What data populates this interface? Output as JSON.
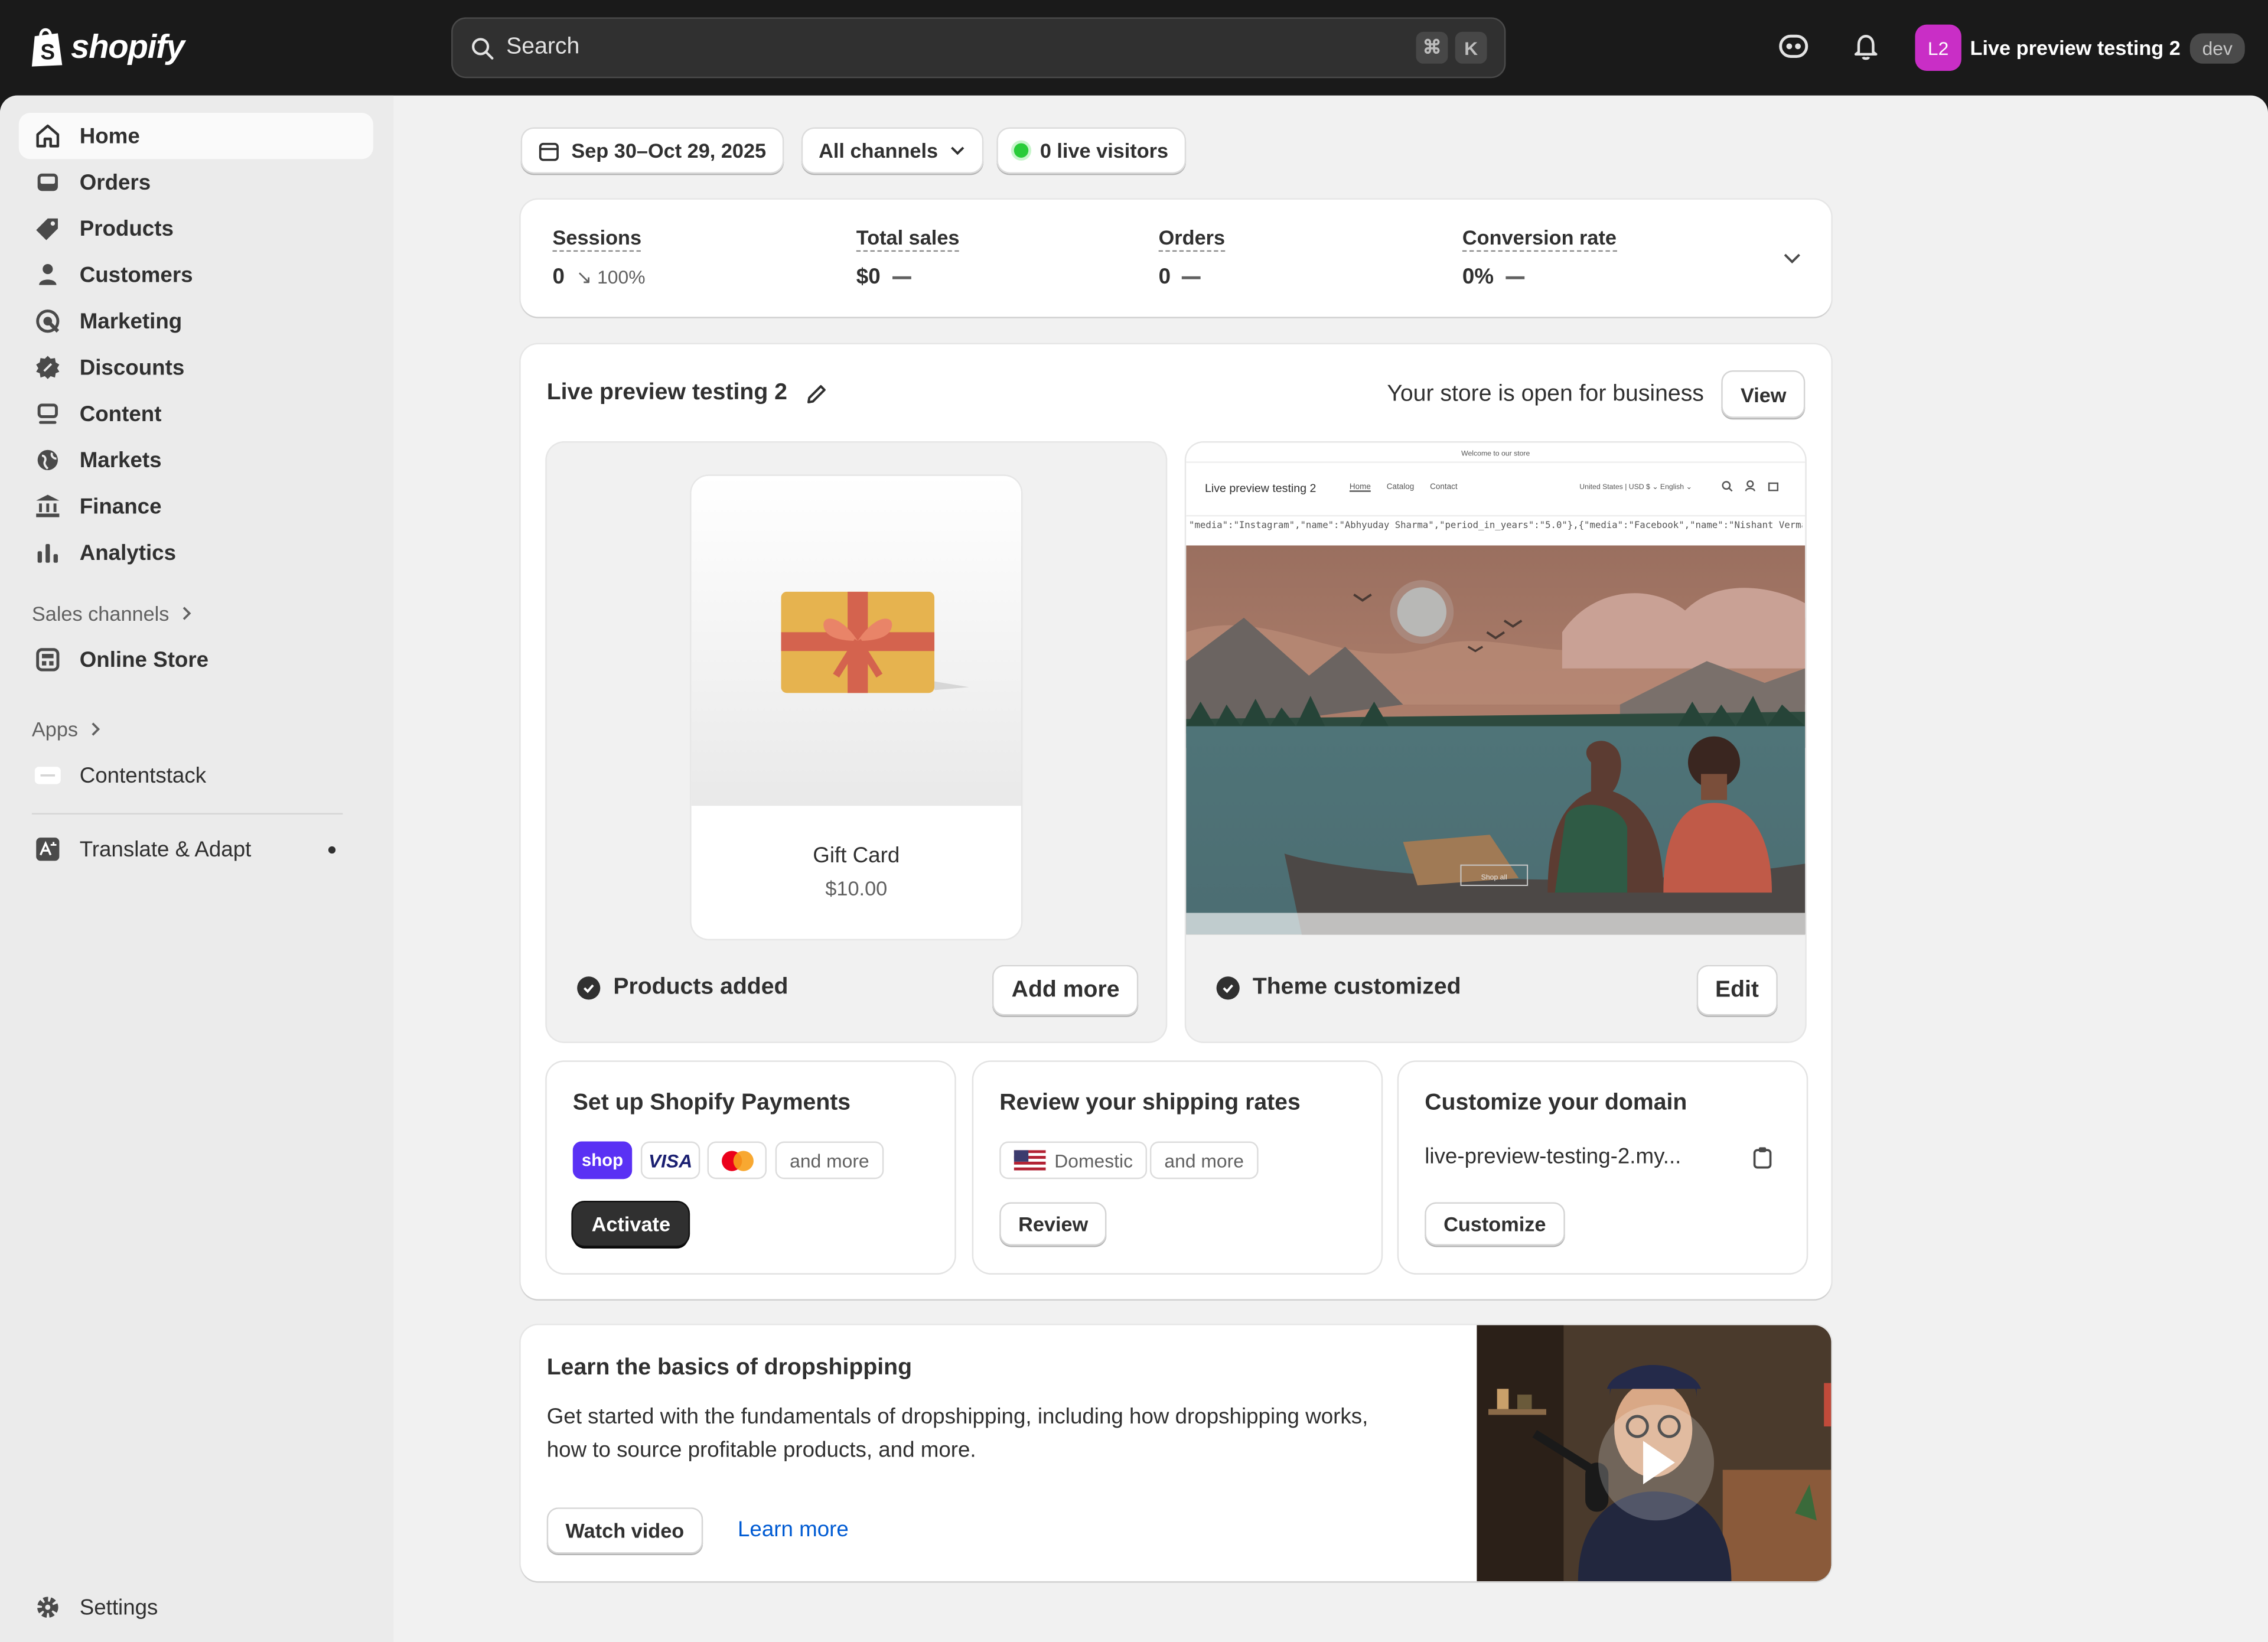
{
  "topbar": {
    "logo_text": "shopify",
    "search_placeholder": "Search",
    "shortcut_keys": [
      "⌘",
      "K"
    ],
    "account": {
      "initials": "L2",
      "name": "Live preview testing 2",
      "badge": "dev",
      "avatar_color": "#c92ec6"
    }
  },
  "sidebar": {
    "items": [
      {
        "label": "Home",
        "icon": "home-icon",
        "active": true
      },
      {
        "label": "Orders",
        "icon": "inbox-icon"
      },
      {
        "label": "Products",
        "icon": "tag-icon"
      },
      {
        "label": "Customers",
        "icon": "person-icon"
      },
      {
        "label": "Marketing",
        "icon": "target-icon"
      },
      {
        "label": "Discounts",
        "icon": "discount-icon"
      },
      {
        "label": "Content",
        "icon": "content-icon"
      },
      {
        "label": "Markets",
        "icon": "globe-icon"
      },
      {
        "label": "Finance",
        "icon": "bank-icon"
      },
      {
        "label": "Analytics",
        "icon": "bar-chart-icon"
      }
    ],
    "sales_channels_label": "Sales channels",
    "online_store_label": "Online Store",
    "apps_label": "Apps",
    "contentstack_label": "Contentstack",
    "translate_label": "Translate & Adapt",
    "settings_label": "Settings"
  },
  "filters": {
    "date_range": "Sep 30–Oct 29, 2025",
    "channels": "All channels",
    "live_visitors": "0 live visitors"
  },
  "metrics": [
    {
      "label": "Sessions",
      "value": "0",
      "change": "100%"
    },
    {
      "label": "Total sales",
      "value": "$0"
    },
    {
      "label": "Orders",
      "value": "0"
    },
    {
      "label": "Conversion rate",
      "value": "0%"
    }
  ],
  "store": {
    "name": "Live preview testing 2",
    "status_text": "Your store is open for business",
    "view_label": "View"
  },
  "product_panel": {
    "product_name": "Gift Card",
    "product_price": "$10.00",
    "status": "Products added",
    "button": "Add more"
  },
  "theme_panel": {
    "preview_announcement": "Welcome to our store",
    "preview_store_name": "Live preview testing 2",
    "preview_nav": [
      "Home",
      "Catalog",
      "Contact"
    ],
    "preview_locale": "United States | USD $ ⌄   English ⌄",
    "preview_json_line": "\"media\":\"Instagram\",\"name\":\"Abhyuday Sharma\",\"period_in_years\":\"5.0\"},{\"media\":\"Facebook\",\"name\":\"Nishant Verma",
    "preview_shop_button": "Shop all",
    "status": "Theme customized",
    "button": "Edit"
  },
  "tasks": {
    "payments": {
      "title": "Set up Shopify Payments",
      "shop_chip": "shop",
      "visa_chip": "VISA",
      "more_chip": "and more",
      "button": "Activate"
    },
    "shipping": {
      "title": "Review your shipping rates",
      "domestic_chip": "Domestic",
      "more_chip": "and more",
      "button": "Review"
    },
    "domain": {
      "title": "Customize your domain",
      "domain_text": "live-preview-testing-2.my...",
      "button": "Customize"
    }
  },
  "learn": {
    "title": "Learn the basics of dropshipping",
    "body": "Get started with the fundamentals of dropshipping, including how dropshipping works, how to source profitable products, and more.",
    "watch_button": "Watch video",
    "learn_link": "Learn more"
  }
}
